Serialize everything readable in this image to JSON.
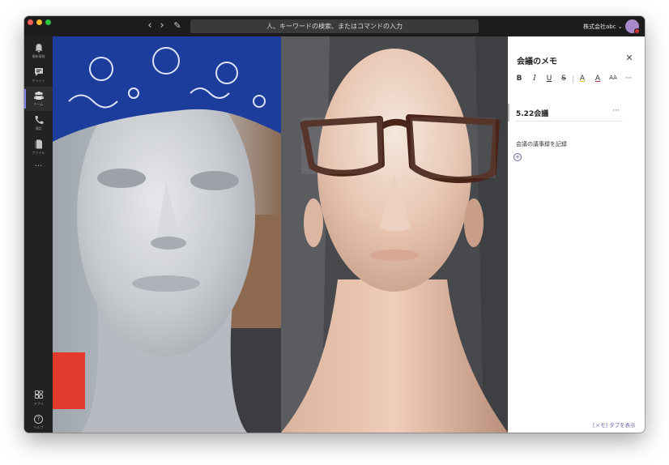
{
  "titlebar": {
    "search_placeholder": "人、キーワードの検索、またはコマンドの入力",
    "org_name": "株式会社abc ⌄",
    "back_glyph": "‹",
    "forward_glyph": "›",
    "compose_glyph": "✎"
  },
  "rail": {
    "items": [
      {
        "label": "最新情報",
        "icon": "bell-icon"
      },
      {
        "label": "チャット",
        "icon": "chat-icon"
      },
      {
        "label": "チーム",
        "icon": "teams-icon"
      },
      {
        "label": "通話",
        "icon": "phone-icon"
      },
      {
        "label": "ファイル",
        "icon": "file-icon"
      }
    ],
    "more_glyph": "···",
    "apps_label": "アプリ",
    "help_label": "ヘルプ",
    "help_glyph": "?"
  },
  "notes": {
    "title": "会議のメモ",
    "close_glyph": "✕",
    "toolbar": {
      "bold": "B",
      "italic": "I",
      "underline": "U",
      "strike": "S",
      "highlight": "A",
      "font_color": "A",
      "font_size": "AA",
      "more": "···"
    },
    "section_title": "5.22会議",
    "section_more": "···",
    "body_text": "会議の議事録を記録",
    "add_glyph": "+",
    "show_tab_text": "[メモ] タブを表示"
  },
  "colors": {
    "accent": "#6264a7",
    "titlebar": "#1c1c1c",
    "rail": "#222222",
    "presence_busy": "#d13438"
  }
}
